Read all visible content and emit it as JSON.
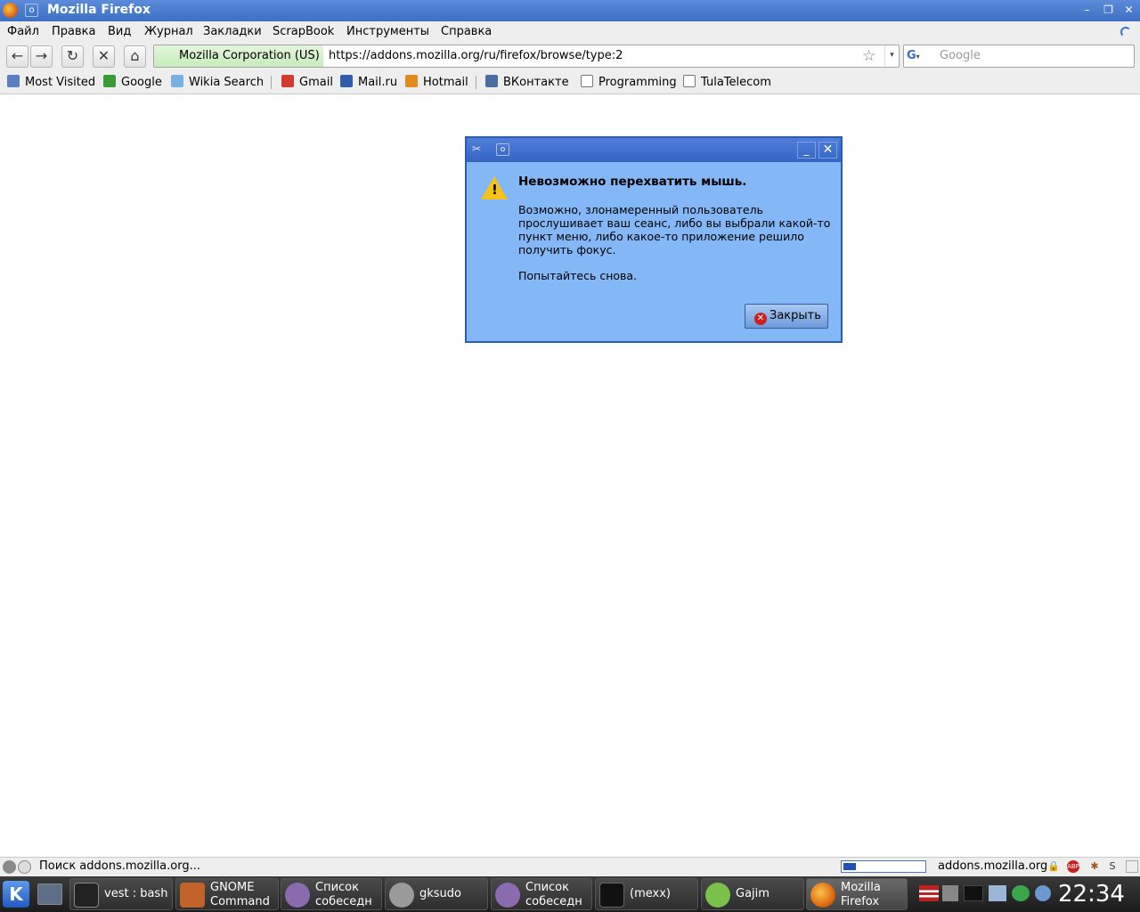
{
  "window": {
    "title": "Mozilla Firefox",
    "pin_glyph": "o",
    "controls": {
      "minimize": "–",
      "maximize": "❐",
      "close": "✕"
    }
  },
  "menu": {
    "items": [
      "Файл",
      "Правка",
      "Вид",
      "Журнал",
      "Закладки",
      "ScrapBook",
      "Инструменты",
      "Справка"
    ]
  },
  "nav": {
    "back_glyph": "←",
    "forward_glyph": "→",
    "reload_glyph": "↻",
    "stop_glyph": "✕",
    "home_glyph": "⌂",
    "identity": "Mozilla Corporation (US)",
    "url": "https://addons.mozilla.org/ru/firefox/browse/type:2",
    "star_glyph": "☆",
    "dropdown_glyph": "▾",
    "search_engine_glyph": "G",
    "search_engine_arrow": "▾",
    "search_placeholder": "Google"
  },
  "bookmarks": {
    "items": [
      {
        "label": "Most Visited",
        "icon": "folder-icon",
        "color": "#5b7fbf"
      },
      {
        "label": "Google",
        "icon": "google-icon",
        "color": "#3a9a3a"
      },
      {
        "label": "Wikia Search",
        "icon": "wikia-icon",
        "color": "#7ab0e0"
      },
      {
        "label": "Gmail",
        "icon": "gmail-icon",
        "color": "#d23c2c"
      },
      {
        "label": "Mail.ru",
        "icon": "at-icon",
        "color": "#2f5da8"
      },
      {
        "label": "Hotmail",
        "icon": "msn-icon",
        "color": "#e38a1f"
      },
      {
        "label": "ВКонтакте",
        "icon": "vk-icon",
        "color": "#4b6fa3"
      },
      {
        "label": "Programming",
        "icon": "page-icon",
        "color": "#ffffff"
      },
      {
        "label": "TulaTelecom",
        "icon": "page-icon",
        "color": "#ffffff"
      }
    ]
  },
  "dialog": {
    "heading": "Невозможно перехватить мышь.",
    "body": "Возможно, злонамеренный пользователь прослушивает ваш сеанс, либо вы выбрали какой-то пункт меню, либо какое-то приложение решило получить фокус.",
    "retry": "Попытайтесь снова.",
    "close_button": "Закрыть",
    "close_button_icon_glyph": "✕",
    "warn_glyph": "!",
    "tool_glyph": "✂",
    "pin_glyph": "o",
    "min_glyph": "_",
    "close_glyph": "✕"
  },
  "status": {
    "text": "Поиск addons.mozilla.org...",
    "progress": 0.15,
    "host": "addons.mozilla.org"
  },
  "taskbar": {
    "kde_glyph": "K",
    "tasks": [
      {
        "lines": [
          "vest : bash"
        ],
        "icon": "terminal-icon",
        "color": "#222222"
      },
      {
        "lines": [
          "GNOME",
          "Command"
        ],
        "icon": "gnome-command-icon",
        "color": "#c0622a"
      },
      {
        "lines": [
          "Список",
          "собеседн"
        ],
        "icon": "pidgin-icon",
        "color": "#8a6bb0"
      },
      {
        "lines": [
          "gksudo"
        ],
        "icon": "gear-icon",
        "color": "#9a9a9a"
      },
      {
        "lines": [
          "Список",
          "собеседн"
        ],
        "icon": "pidgin-icon",
        "color": "#8a6bb0"
      },
      {
        "lines": [
          "(mexx)"
        ],
        "icon": "skull-icon",
        "color": "#111111"
      },
      {
        "lines": [
          "Gajim"
        ],
        "icon": "gajim-icon",
        "color": "#7ac04a"
      },
      {
        "lines": [
          "Mozilla",
          "Firefox"
        ],
        "icon": "firefox-icon",
        "color": "#e06a14"
      }
    ],
    "clock": "22:34"
  }
}
